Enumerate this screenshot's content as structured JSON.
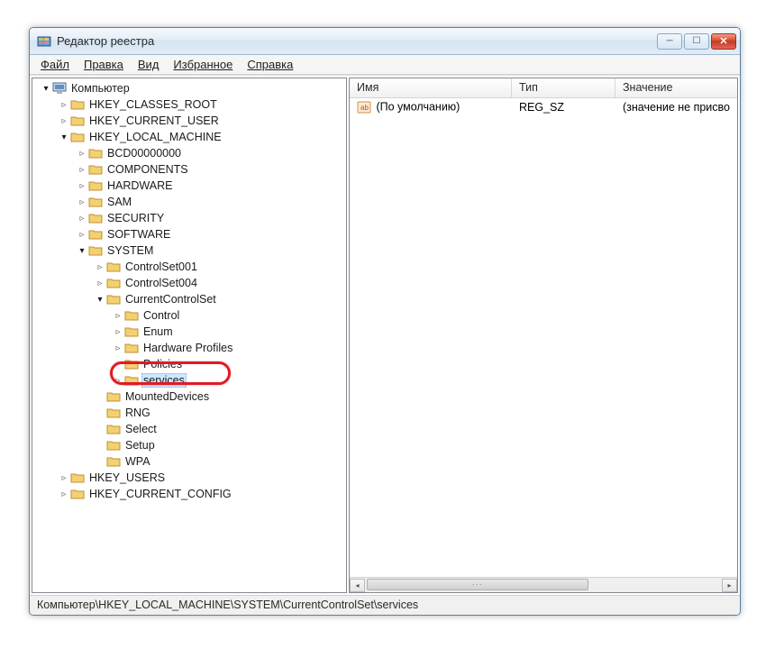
{
  "window": {
    "title": "Редактор реестра"
  },
  "menu": {
    "file": "Файл",
    "edit": "Правка",
    "view": "Вид",
    "favorites": "Избранное",
    "help": "Справка"
  },
  "tree": {
    "root": "Компьютер",
    "hkcr": "HKEY_CLASSES_ROOT",
    "hkcu": "HKEY_CURRENT_USER",
    "hklm": "HKEY_LOCAL_MACHINE",
    "hklm_children": {
      "bcd": "BCD00000000",
      "components": "COMPONENTS",
      "hardware": "HARDWARE",
      "sam": "SAM",
      "security": "SECURITY",
      "software": "SOFTWARE",
      "system": "SYSTEM"
    },
    "system_children": {
      "cs001": "ControlSet001",
      "cs004": "ControlSet004",
      "ccs": "CurrentControlSet",
      "mounted": "MountedDevices",
      "rng": "RNG",
      "select": "Select",
      "setup": "Setup",
      "wpa": "WPA"
    },
    "ccs_children": {
      "control": "Control",
      "enum": "Enum",
      "hwprofiles": "Hardware Profiles",
      "policies": "Policies",
      "services": "services"
    },
    "hku": "HKEY_USERS",
    "hkcc": "HKEY_CURRENT_CONFIG"
  },
  "list": {
    "col_name": "Имя",
    "col_type": "Тип",
    "col_value": "Значение",
    "default_name": "(По умолчанию)",
    "default_type": "REG_SZ",
    "default_value": "(значение не присво"
  },
  "status": {
    "path": "Компьютер\\HKEY_LOCAL_MACHINE\\SYSTEM\\CurrentControlSet\\services"
  }
}
